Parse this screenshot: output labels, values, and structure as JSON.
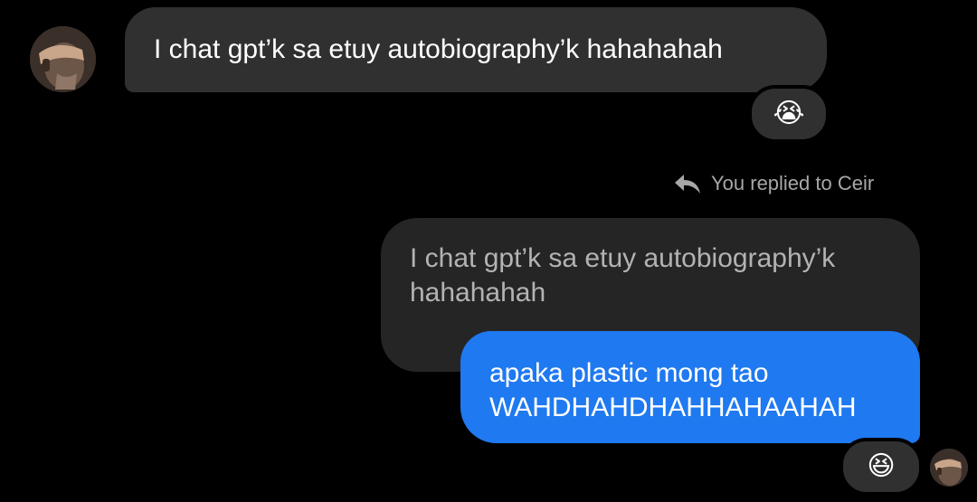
{
  "conversation": {
    "incoming_message": {
      "text": "I chat gpt’k sa etuy autobiography’k hahahahah",
      "reaction": "😭",
      "bubble_color": "#303030"
    },
    "reply_indicator": {
      "text": "You replied to Ceir",
      "icon": "reply-arrow-icon"
    },
    "quoted_message": {
      "text": "I chat gpt’k sa etuy autobiography’k hahahahah"
    },
    "outgoing_message": {
      "text": "apaka plastic mong tao WAHDHAHDHAHHAHAAHAH",
      "reaction": "😆",
      "bubble_color": "#1f79f0"
    },
    "sender_avatar": "avatar-icon",
    "self_avatar": "avatar-icon"
  },
  "theme": {
    "background": "#000000",
    "text_secondary": "#a7a7a7"
  }
}
